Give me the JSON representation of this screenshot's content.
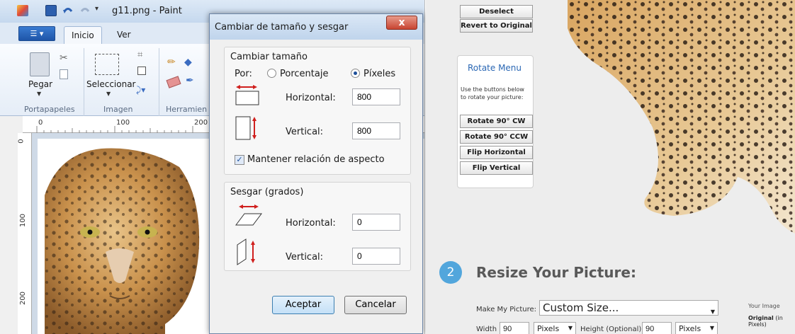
{
  "paint": {
    "title": "g11.png - Paint",
    "tabs": [
      "Inicio",
      "Ver"
    ],
    "buttons": {
      "paste": "Pegar",
      "select": "Seleccionar"
    },
    "groups": {
      "clipboard": "Portapapeles",
      "image": "Imagen",
      "tools": "Herramien"
    },
    "ruler_h": [
      "0",
      "100",
      "200"
    ],
    "ruler_v": [
      "0",
      "100",
      "200"
    ]
  },
  "dialog": {
    "title": "Cambiar de tamaño y sesgar",
    "resize_group": "Cambiar tamaño",
    "por_label": "Por:",
    "percent_label": "Porcentaje",
    "pixels_label": "Píxeles",
    "horizontal_label": "Horizontal:",
    "vertical_label": "Vertical:",
    "resize_horizontal": "800",
    "resize_vertical": "800",
    "keep_aspect_label": "Mantener relación de aspecto",
    "skew_group": "Sesgar (grados)",
    "skew_horizontal": "0",
    "skew_vertical": "0",
    "ok_label": "Aceptar",
    "cancel_label": "Cancelar",
    "close_glyph": "x"
  },
  "web": {
    "deselect_label": "Deselect",
    "revert_label": "Revert to Original",
    "rotate_menu_title": "Rotate Menu",
    "rotate_desc": "Use the buttons below to rotate your picture:",
    "rotate_cw": "Rotate 90° CW",
    "rotate_ccw": "Rotate 90° CCW",
    "flip_h": "Flip Horizontal",
    "flip_v": "Flip Vertical",
    "step_number": "2",
    "step_title": "Resize Your Picture:",
    "make_label": "Make My Picture:",
    "make_value": "Custom Size...",
    "width_label": "Width",
    "width_value": "90",
    "unit_1": "Pixels",
    "height_label": "Height (Optional)",
    "height_value": "90",
    "unit_2": "Pixels",
    "your_image": "Your Image",
    "original_bold": "Original",
    "original_rest": "(in Pixels)"
  }
}
